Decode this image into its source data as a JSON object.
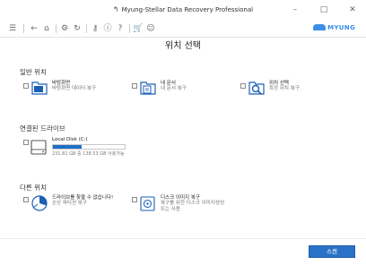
{
  "app": {
    "title": "Myung-Stellar Data Recovery Professional"
  },
  "toolbar": {
    "logo_text": "MYUNG"
  },
  "page": {
    "title": "위치 선택"
  },
  "sections": {
    "general": {
      "title": "일반 위치",
      "items": [
        {
          "title": "바탕화면",
          "desc": "바탕화면 데이터 복구"
        },
        {
          "title": "내 문서",
          "desc": "내 문서 복구"
        },
        {
          "title": "위치 선택",
          "desc": "특정 위치 복구"
        }
      ]
    },
    "drives": {
      "title": "연결된 드라이브",
      "items": [
        {
          "title": "Local Disk (C:)",
          "desc": "231.81 GB 중 138.53 GB 사용가능",
          "used_fraction": 0.4
        }
      ]
    },
    "other": {
      "title": "다른 위치",
      "items": [
        {
          "title": "드라이브를 찾을 수 없습니다!",
          "desc": "손상 파티션 복구"
        },
        {
          "title": "디스크 이미지 복구",
          "desc_line1": "복구를 위한 디스크 이미지생성",
          "desc_line2": "또는 사용"
        }
      ]
    }
  },
  "actions": {
    "scan_label": "스캔"
  },
  "colors": {
    "accent": "#2a72c7",
    "drive_fill": "#1e6fc8",
    "icon_blue": "#1a5fb4"
  }
}
